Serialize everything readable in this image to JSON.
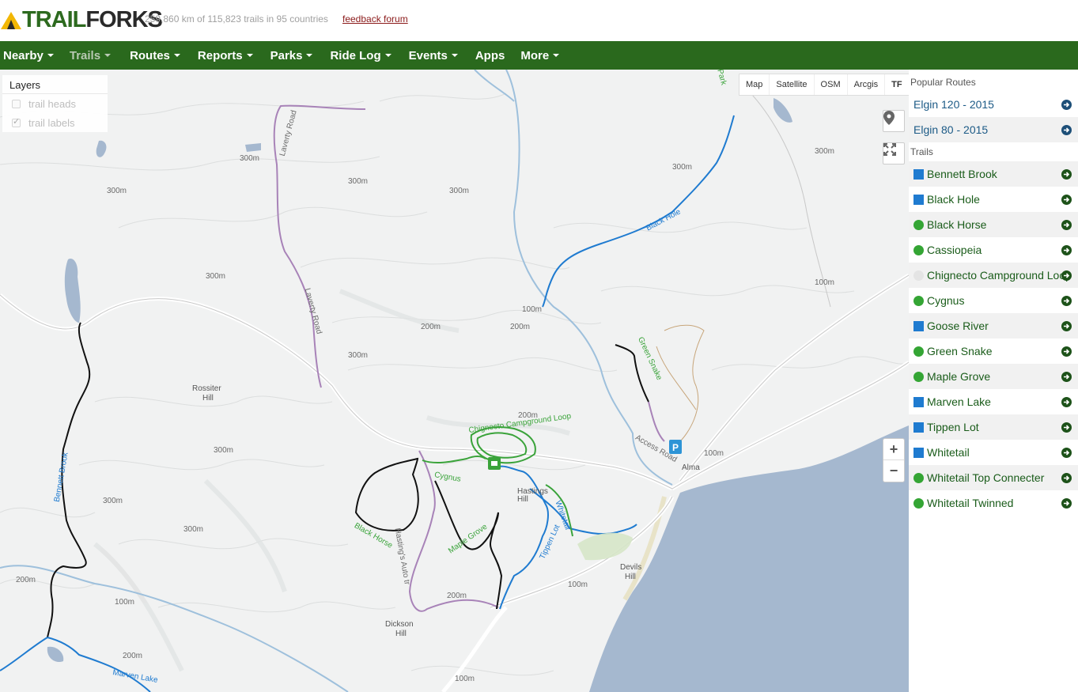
{
  "header": {
    "logo_trail": "TRAIL",
    "logo_forks": "FORKS",
    "stats": "259,860 km of 115,823 trails in 95 countries",
    "feedback": "feedback forum"
  },
  "nav": [
    {
      "label": "Nearby",
      "caret": true
    },
    {
      "label": "Trails",
      "caret": true,
      "active": true
    },
    {
      "label": "Routes",
      "caret": true
    },
    {
      "label": "Reports",
      "caret": true
    },
    {
      "label": "Parks",
      "caret": true
    },
    {
      "label": "Ride Log",
      "caret": true
    },
    {
      "label": "Events",
      "caret": true
    },
    {
      "label": "Apps",
      "caret": false
    },
    {
      "label": "More",
      "caret": true
    }
  ],
  "layers": {
    "title": "Layers",
    "items": [
      {
        "label": "trail heads",
        "checked": false
      },
      {
        "label": "trail labels",
        "checked": true
      }
    ]
  },
  "map_types": [
    "Map",
    "Satellite",
    "OSM",
    "Arcgis",
    "TF"
  ],
  "map_labels": {
    "rossiter": "Rossiter",
    "rossiter2": "Hill",
    "dickson": "Dickson",
    "dickson2": "Hill",
    "devils": "Devils",
    "devils2": "Hill",
    "hastings": "Hastings",
    "hastings2": "Hill",
    "alma": "Alma",
    "laverty1": "Laverty Road",
    "laverty2": "Laverty Road",
    "access": "Access Road",
    "hastings_auto": "Hasting's Auto tr",
    "park": "Park",
    "c300": "300m",
    "c200": "200m",
    "c100": "100m"
  },
  "trail_labels": {
    "black_hole": "Black Hole",
    "green_snake": "Green Snake",
    "bennett": "Bennett Brook",
    "black_horse": "Black Horse",
    "maple": "Maple Grove",
    "cygnus": "Cygnus",
    "tippen": "Tippen Lot",
    "whitetail": "Whitetail",
    "marven": "Marven Lake",
    "chignecto": "Chignecto Campground Loop"
  },
  "zoom": {
    "in": "+",
    "out": "−"
  },
  "sidebar": {
    "routes_heading": "Popular Routes",
    "routes": [
      "Elgin 120 - 2015",
      "Elgin 80 - 2015"
    ],
    "trails_heading": "Trails",
    "trails": [
      {
        "label": "Bennett Brook",
        "difficulty": "blue"
      },
      {
        "label": "Black Hole",
        "difficulty": "blue"
      },
      {
        "label": "Black Horse",
        "difficulty": "green"
      },
      {
        "label": "Cassiopeia",
        "difficulty": "green"
      },
      {
        "label": "Chignecto Campground Loop",
        "difficulty": "none"
      },
      {
        "label": "Cygnus",
        "difficulty": "green"
      },
      {
        "label": "Goose River",
        "difficulty": "blue"
      },
      {
        "label": "Green Snake",
        "difficulty": "green"
      },
      {
        "label": "Maple Grove",
        "difficulty": "green"
      },
      {
        "label": "Marven Lake",
        "difficulty": "blue"
      },
      {
        "label": "Tippen Lot",
        "difficulty": "blue"
      },
      {
        "label": "Whitetail",
        "difficulty": "blue"
      },
      {
        "label": "Whitetail Top Connecter",
        "difficulty": "green"
      },
      {
        "label": "Whitetail Twinned",
        "difficulty": "green"
      }
    ]
  },
  "colors": {
    "nav_bg": "#2a691d",
    "trail_black": "#111111",
    "trail_blue": "#1f7bd0",
    "trail_green": "#3aa33a",
    "road_purple": "#a883b8",
    "water": "#a5b8cf"
  }
}
